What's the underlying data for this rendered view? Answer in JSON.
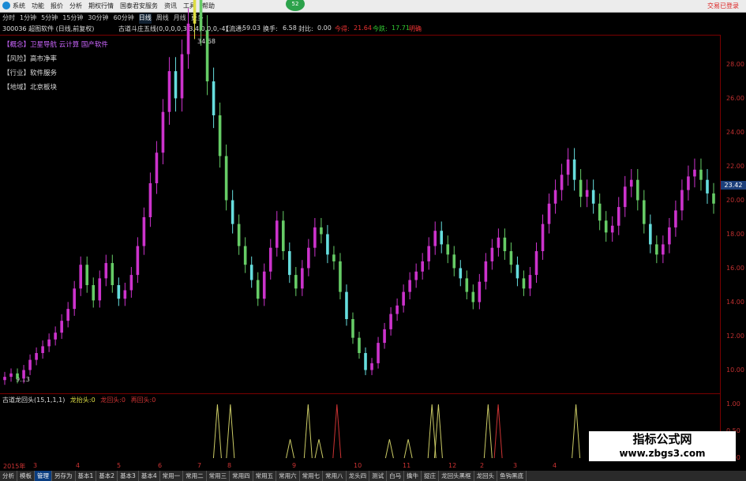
{
  "menubar": {
    "items": [
      "系统",
      "功能",
      "报价",
      "分析",
      "期权行情",
      "国泰君安服务",
      "资讯",
      "工具",
      "帮助"
    ],
    "badge": "52",
    "status": "交易已登录"
  },
  "periods": [
    "分时",
    "1分钟",
    "5分钟",
    "15分钟",
    "30分钟",
    "60分钟",
    "日线",
    "周线",
    "月线",
    "更多"
  ],
  "active_period": "日线",
  "title": {
    "code_name": "300036 超图软件 (日线,前复权)",
    "indicator": "古道斗庄五线(0,0,0,0,3,3,4,0,0,0,-4)",
    "liutong_label": "【流通:",
    "liutong_value": "59.03",
    "huanshou_label": "换手:",
    "huanshou_value": "6.58",
    "fengbi_label": "封比:",
    "fengbi_value": "0.00",
    "jindi_label": "今得:",
    "jindi_value": "21.64",
    "jinzhang_label": "今跌:",
    "jinzhang_value": "17.71",
    "more": "明确"
  },
  "info_lines": [
    {
      "key": "【概念】",
      "value": "卫星导航  云计算  国产软件"
    },
    {
      "key": "【风险】",
      "value": "高市净率"
    },
    {
      "key": "【行业】",
      "value": "软件服务"
    },
    {
      "key": "【地域】",
      "value": "北京板块"
    }
  ],
  "price_axis": {
    "ticks": [
      "28.00",
      "26.00",
      "24.00",
      "22.00",
      "20.00",
      "18.00",
      "16.00",
      "14.00",
      "12.00",
      "10.00"
    ],
    "current": "23.42"
  },
  "annotations": {
    "high": "34.68",
    "low": "9.13"
  },
  "sub_indicator": {
    "name": "古道龙回头(15,1,1,1)",
    "l1": "龙抬头:",
    "v1": "0",
    "l2": "龙回头:",
    "v2": "0",
    "l3": "再回头:",
    "v3": "0",
    "ticks": [
      "1.00",
      "0.50",
      "0.00"
    ]
  },
  "date_axis": [
    "2015年",
    "3",
    "4",
    "5",
    "6",
    "7",
    "8",
    "9",
    "10",
    "11",
    "12",
    "2",
    "3",
    "4"
  ],
  "tabs": [
    "分析",
    "模板",
    "管理",
    "另存为",
    "基本1",
    "基本2",
    "基本3",
    "基本4",
    "常用一",
    "常用二",
    "常用三",
    "常用四",
    "常用五",
    "常用六",
    "常用七",
    "常用八",
    "龙头四",
    "测试",
    "白马",
    "擒牛",
    "捉庄",
    "龙回头黑框",
    "龙回头",
    "鱼钩黑底"
  ],
  "active_tab": "管理",
  "watermark": {
    "line1": "指标公式网",
    "line2": "www.zbgs3.com"
  },
  "chart_data": {
    "type": "candlestick",
    "ylim": [
      9,
      29
    ],
    "y_ticks": [
      10,
      12,
      14,
      16,
      18,
      20,
      22,
      24,
      26,
      28
    ],
    "closes": [
      9.6,
      9.8,
      9.5,
      10.0,
      10.6,
      11.0,
      11.4,
      11.8,
      12.2,
      12.9,
      13.6,
      14.8,
      16.2,
      15.0,
      14.1,
      15.4,
      16.3,
      15.0,
      14.2,
      14.7,
      15.6,
      17.3,
      19.0,
      21.0,
      22.8,
      25.2,
      27.6,
      26.0,
      28.6,
      30.4,
      34.68,
      30.0,
      27.0,
      25.0,
      22.6,
      20.0,
      18.6,
      17.3,
      16.2,
      15.3,
      14.2,
      15.8,
      17.2,
      18.8,
      17.0,
      15.6,
      14.8,
      16.0,
      17.2,
      18.4,
      18.0,
      16.8,
      16.4,
      14.6,
      13.0,
      11.9,
      11.0,
      10.0,
      10.4,
      11.6,
      12.4,
      13.3,
      13.8,
      14.6,
      15.3,
      15.8,
      16.4,
      17.3,
      18.2,
      17.4,
      16.8,
      16.0,
      15.4,
      14.6,
      14.0,
      15.2,
      16.4,
      17.2,
      17.8,
      17.0,
      16.2,
      15.4,
      14.8,
      15.6,
      17.0,
      18.6,
      19.8,
      20.6,
      21.5,
      22.4,
      21.2,
      20.2,
      20.6,
      19.8,
      18.8,
      18.1,
      18.5,
      19.6,
      20.8,
      21.2,
      20.0,
      18.6,
      17.4,
      16.8,
      17.4,
      18.4,
      19.4,
      20.6,
      21.4,
      21.8,
      21.2,
      20.4,
      19.8
    ],
    "signals": [
      {
        "x": 0.302,
        "h": 1.0,
        "color": "#cccc66"
      },
      {
        "x": 0.32,
        "h": 1.0,
        "color": "#cccc66"
      },
      {
        "x": 0.403,
        "h": 0.35,
        "color": "#cccc66"
      },
      {
        "x": 0.428,
        "h": 1.0,
        "color": "#cccc66"
      },
      {
        "x": 0.443,
        "h": 0.35,
        "color": "#cccc66"
      },
      {
        "x": 0.468,
        "h": 1.0,
        "color": "#cc3333"
      },
      {
        "x": 0.541,
        "h": 0.35,
        "color": "#cccc66"
      },
      {
        "x": 0.567,
        "h": 0.35,
        "color": "#cccc66"
      },
      {
        "x": 0.6,
        "h": 1.0,
        "color": "#cccc66"
      },
      {
        "x": 0.609,
        "h": 1.0,
        "color": "#cccc66"
      },
      {
        "x": 0.678,
        "h": 1.0,
        "color": "#cccc66"
      },
      {
        "x": 0.692,
        "h": 1.0,
        "color": "#cc3333"
      },
      {
        "x": 0.8,
        "h": 1.0,
        "color": "#cccc66"
      }
    ],
    "colors": {
      "up": "#cc33cc",
      "down": "#66cc66",
      "alt": "#66dddd",
      "flat": "#dddd44"
    }
  }
}
